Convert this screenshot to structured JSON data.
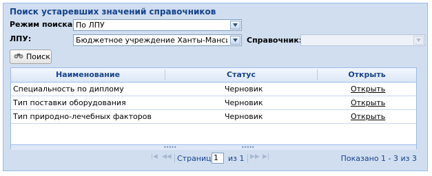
{
  "panel": {
    "title": "Поиск устаревших значений справочников"
  },
  "filters": {
    "search_mode_label": "Режим поиска:",
    "search_mode_value": "По ЛПУ",
    "lpu_label": "ЛПУ:",
    "lpu_value": "Бюджетное учреждение Ханты-Мансийского",
    "directory_label": "Справочник:",
    "directory_value": ""
  },
  "search_button": {
    "label": "Поиск",
    "icon": "binoculars-icon"
  },
  "grid": {
    "columns": [
      "Наименование",
      "Статус",
      "Открыть"
    ],
    "rows": [
      {
        "name": "Специальность по диплому",
        "status": "Черновик",
        "open": "Открыть"
      },
      {
        "name": "Тип поставки оборудования",
        "status": "Черновик",
        "open": "Открыть"
      },
      {
        "name": "Тип природно-лечебных факторов",
        "status": "Черновик",
        "open": "Открыть"
      }
    ]
  },
  "pager": {
    "page_label": "Страница",
    "page_value": "1",
    "of_label": "из 1",
    "summary": "Показано 1 - 3 из 3"
  },
  "colors": {
    "header_text": "#15428b",
    "panel_bg": "#d0def0",
    "border": "#99bbe8"
  }
}
